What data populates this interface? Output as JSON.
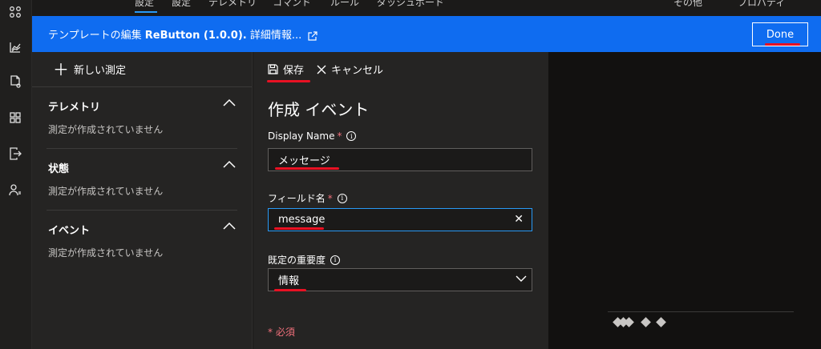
{
  "top_tabs": [
    "設定",
    "設定",
    "テレメトリ",
    "コマンド",
    "ルール",
    "ダッシュボード",
    "その他",
    "プロパティ"
  ],
  "banner": {
    "prefix": "テンプレートの編集",
    "device": "ReButton (1.0.0).",
    "more": "詳細情報...",
    "done_label": "Done"
  },
  "left_panel": {
    "new_measure_label": "新しい測定",
    "sections": [
      {
        "title": "テレメトリ",
        "empty": "測定が作成されていません"
      },
      {
        "title": "状態",
        "empty": "測定が作成されていません"
      },
      {
        "title": "イベント",
        "empty": "測定が作成されていません"
      }
    ]
  },
  "form": {
    "save_label": "保存",
    "cancel_label": "キャンセル",
    "title": "作成 イベント",
    "display_name": {
      "label": "Display Name",
      "required_mark": "*",
      "value": "メッセージ"
    },
    "field_name": {
      "label": "フィールド名",
      "required_mark": "*",
      "value": "message"
    },
    "severity": {
      "label": "既定の重要度",
      "value": "情報"
    },
    "required_note": "* 必須"
  },
  "colors": {
    "banner": "#0f6cf0",
    "accent": "#2899f5",
    "annotation": "#e81123",
    "required": "#f1707b"
  },
  "icons": [
    "grid-icon",
    "chart-icon",
    "document-icon",
    "dashboard-icon",
    "export-icon",
    "people-icon",
    "external-link-icon",
    "plus-icon",
    "chevron-up-icon",
    "save-icon",
    "close-icon",
    "info-icon",
    "clear-icon",
    "chevron-down-icon"
  ]
}
